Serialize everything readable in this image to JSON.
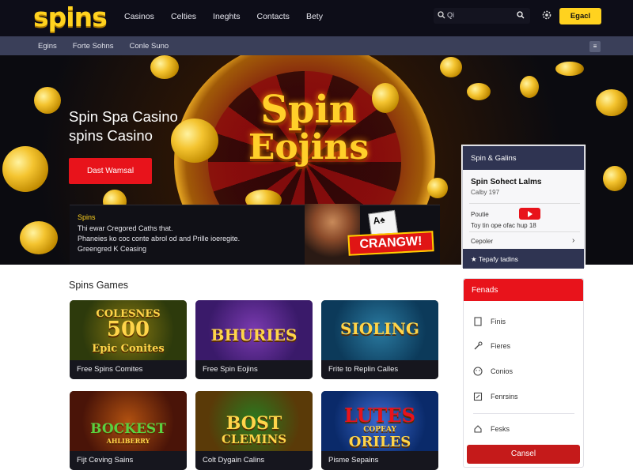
{
  "header": {
    "logo": "spins",
    "nav": [
      "Casinos",
      "Celties",
      "Ineghts",
      "Contacts",
      "Bety"
    ],
    "search_placeholder": "Qi",
    "signup_label": "Egacl"
  },
  "subnav": {
    "items": [
      "Egins",
      "Forte Sohns",
      "Conle Suno"
    ],
    "toggle_label": "≡"
  },
  "hero": {
    "title_line1": "Spin Spa Casino",
    "title_line2": "spins Casino",
    "cta_label": "Dast Wamsal",
    "wheel_line1": "Spin",
    "wheel_line2": "Eojins",
    "promo_line1": "Spins",
    "promo_line2": "Thi ewar Cregored Caths that.",
    "promo_line3": "Phaneies ko coc conte abrol od and Prille ioeregite.",
    "promo_line4": "Greengred K Ceasing",
    "promo_badge": "CRANGW!",
    "promo_card": "A♠"
  },
  "side_panel": {
    "header": "Spin & Galins",
    "subtitle": "Spin Sohect Lalms",
    "subtitle_small": "Calby 197",
    "row1_label": "Poutie",
    "row2_label": "Toy tin ope ofac hup 18",
    "row3_label": "Cepoler",
    "footer": "Tepafy tadins"
  },
  "games": {
    "section_title": "Spins Games",
    "cards": [
      {
        "art_top": "COLESNES",
        "art_mid": "500",
        "art_bot": "Epic Conites",
        "caption": "Free Spins Comites",
        "bg": "#2d3a0c"
      },
      {
        "art_top": "",
        "art_mid": "BHURIES",
        "art_bot": "",
        "caption": "Free Spin Eojins",
        "bg": "#3a1a6a"
      },
      {
        "art_top": "",
        "art_mid": "SIOLING",
        "art_bot": "",
        "caption": "Frite to Replin Calles",
        "bg": "#0c3a5a"
      },
      {
        "art_top": "",
        "art_mid": "BOCKEST",
        "art_bot": "AHLIBERRY",
        "caption": "Fijt Ceving Sains",
        "bg": "#4a1408"
      },
      {
        "art_top": "",
        "art_mid": "BOST",
        "art_bot": "CLEMINS",
        "caption": "Colt Dygain Calins",
        "bg": "#5a3a08"
      },
      {
        "art_top": "LUTES",
        "art_mid": "COPEAY",
        "art_bot": "ORILES",
        "caption": "Pisme Sepains",
        "bg": "#0a2a6a"
      }
    ]
  },
  "right_panel": {
    "header": "Fenads",
    "items": [
      "Finis",
      "Fieres",
      "Conios",
      "Fenrsins",
      "Fesks"
    ],
    "button": "Cansel"
  },
  "colors": {
    "accent": "#ffd21f",
    "red": "#e8131b",
    "nav_bg": "#0d0d18",
    "subnav_bg": "#3a3f59"
  }
}
